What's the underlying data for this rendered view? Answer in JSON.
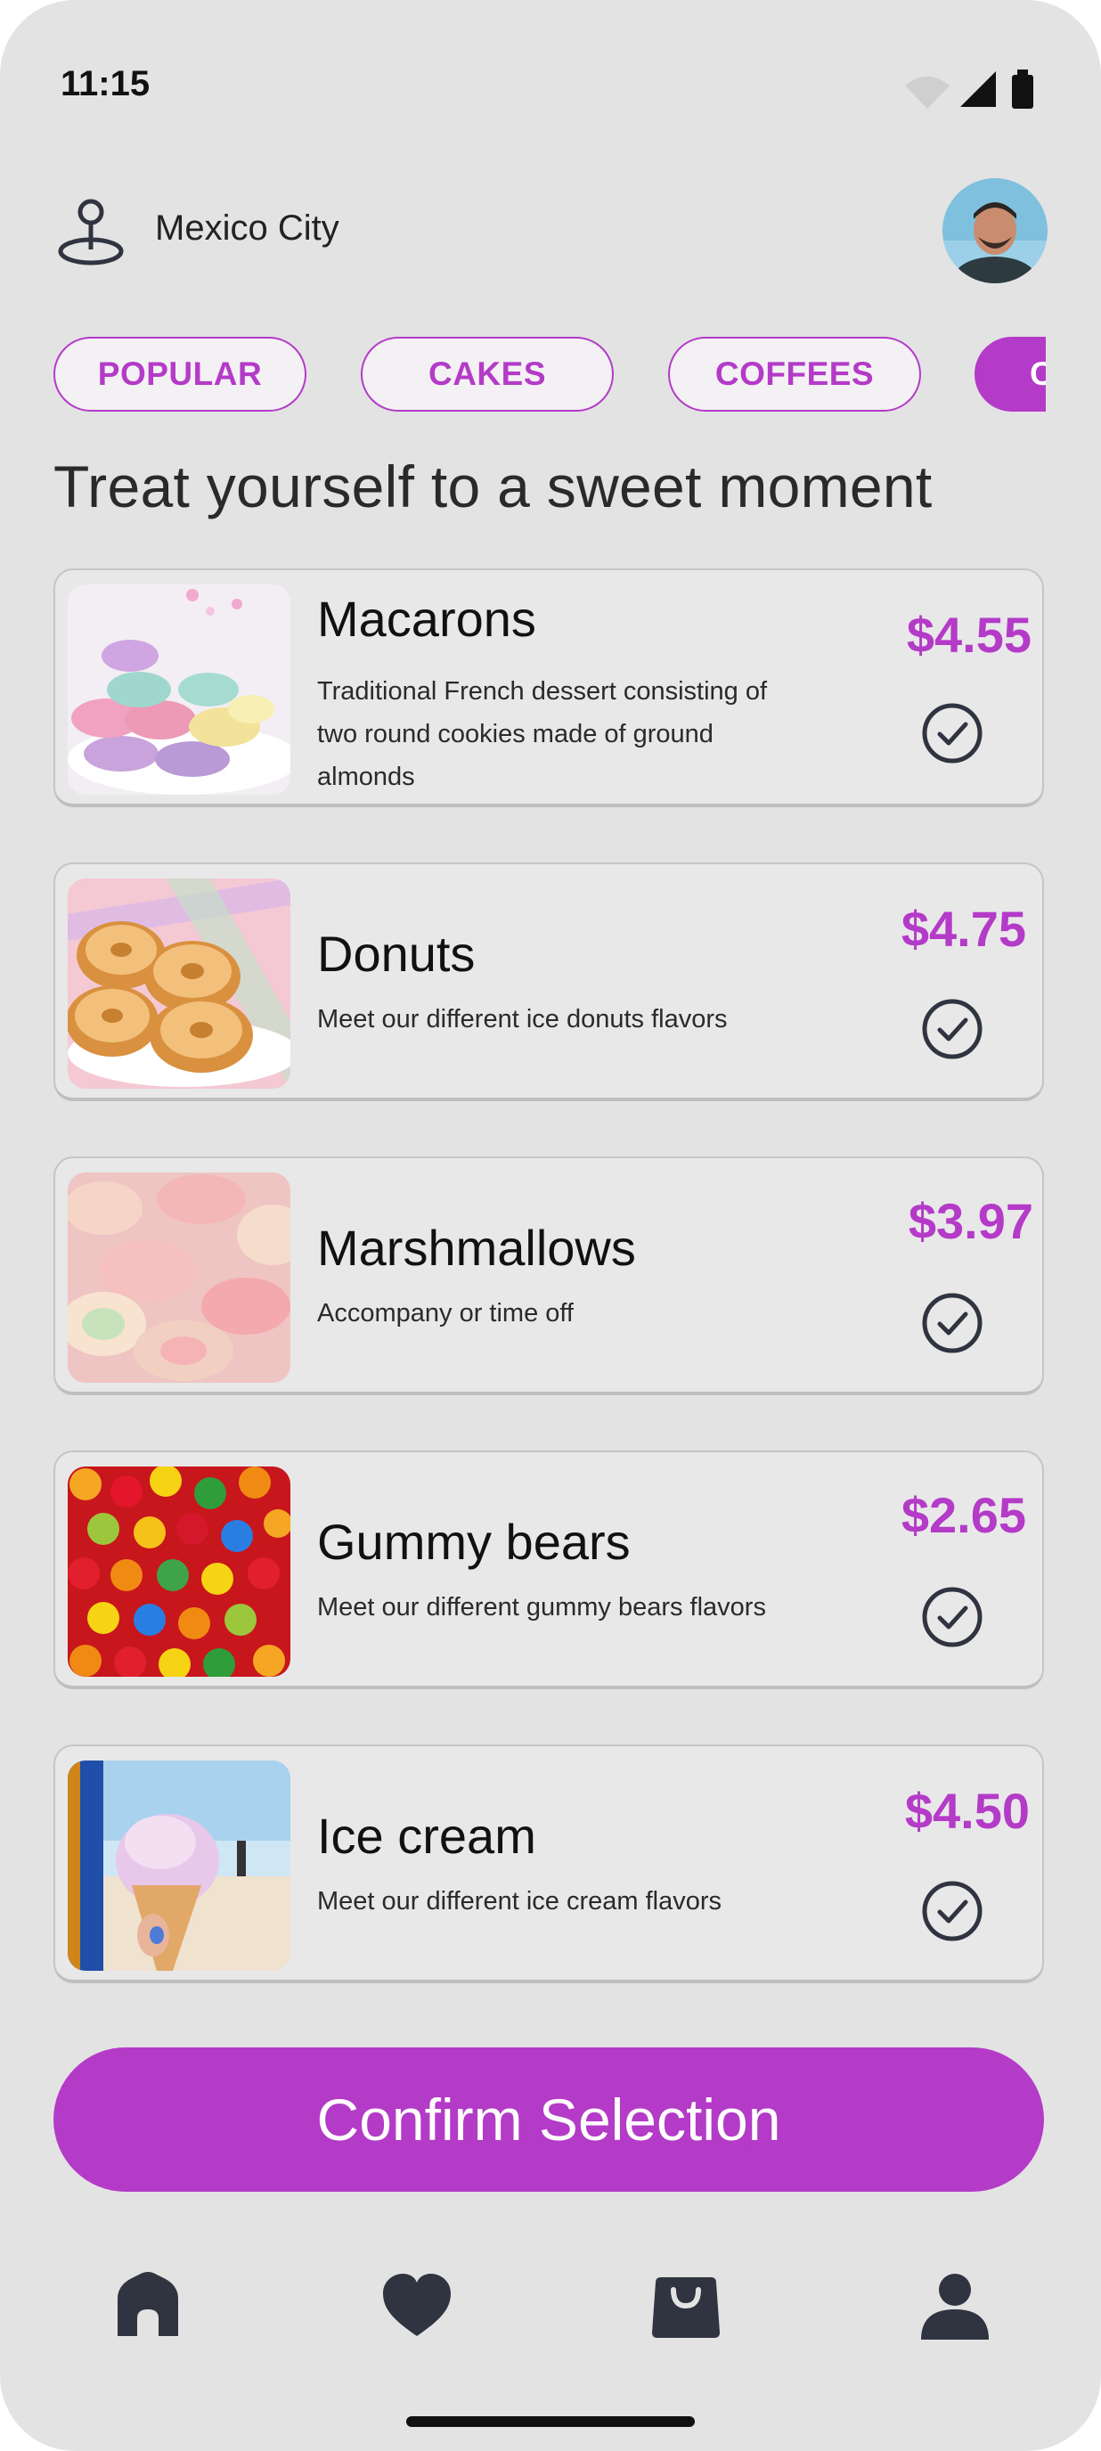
{
  "status_bar": {
    "time": "11:15"
  },
  "location": {
    "label": "Mexico City"
  },
  "categories": [
    {
      "label": "POPULAR"
    },
    {
      "label": "CAKES"
    },
    {
      "label": "COFFEES"
    },
    {
      "label": "C"
    }
  ],
  "heading": "Treat yourself to a sweet moment",
  "products": [
    {
      "name": "Macarons",
      "description": "Traditional French dessert consisting of two round cookies made of ground almonds",
      "price": "$4.55"
    },
    {
      "name": "Donuts",
      "description": "Meet our different ice donuts flavors",
      "price": "$4.75"
    },
    {
      "name": "Marshmallows",
      "description": "Accompany or time off",
      "price": "$3.97"
    },
    {
      "name": "Gummy bears",
      "description": "Meet our different gummy bears flavors",
      "price": "$2.65"
    },
    {
      "name": "Ice cream",
      "description": "Meet our different ice cream flavors",
      "price": "$4.50"
    }
  ],
  "confirm_label": "Confirm Selection",
  "colors": {
    "accent": "#b43bc8",
    "background": "#e4e3e4",
    "card": "#e9e8e9",
    "icon": "#2f3440"
  },
  "nav": [
    "home-icon",
    "heart-icon",
    "shopping-bag-icon",
    "profile-icon"
  ]
}
